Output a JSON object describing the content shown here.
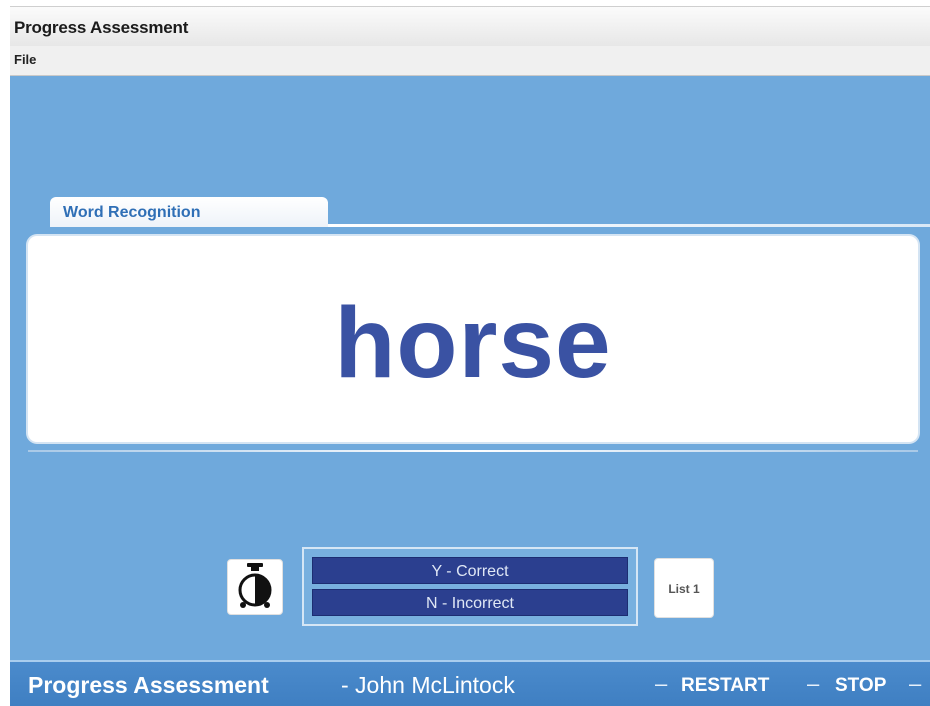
{
  "window": {
    "title": "Progress Assessment"
  },
  "menu": {
    "file": "File"
  },
  "tab": {
    "label": "Word Recognition"
  },
  "card": {
    "word": "horse"
  },
  "controls": {
    "timer_icon": "stopwatch-icon",
    "correct_label": "Y - Correct",
    "incorrect_label": "N - Incorrect",
    "list_label": "List 1"
  },
  "footer": {
    "app_name": "Progress Assessment",
    "user": "- John McLintock",
    "separator": "–",
    "restart": "RESTART",
    "stop": "STOP"
  },
  "colors": {
    "background": "#6fa9dc",
    "word": "#3a52a3",
    "answer_button": "#2b3f8f",
    "footer": "#4383c6"
  }
}
